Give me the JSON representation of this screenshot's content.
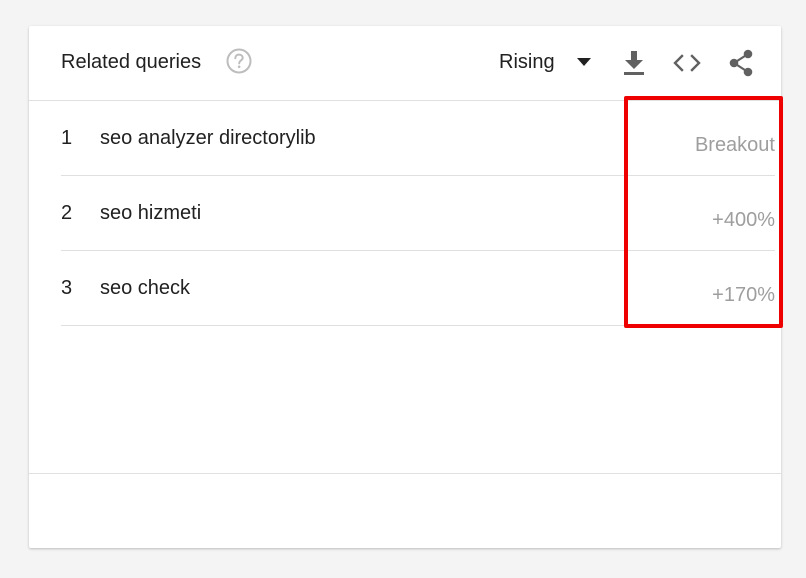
{
  "header": {
    "title": "Related queries",
    "help_icon": "help-circle-icon",
    "dropdown": {
      "selected": "Rising",
      "icon": "caret-down-icon"
    },
    "tools": [
      {
        "name": "download",
        "icon": "download-icon"
      },
      {
        "name": "embed",
        "icon": "code-icon"
      },
      {
        "name": "share",
        "icon": "share-icon"
      }
    ]
  },
  "rows": [
    {
      "rank": "1",
      "query": "seo analyzer directorylib",
      "value": "Breakout"
    },
    {
      "rank": "2",
      "query": "seo hizmeti",
      "value": "+400%"
    },
    {
      "rank": "3",
      "query": "seo check",
      "value": "+170%"
    }
  ],
  "colors": {
    "text_primary": "#212121",
    "text_secondary": "#9e9e9e",
    "icon": "#616161",
    "highlight": "#ee0000"
  }
}
